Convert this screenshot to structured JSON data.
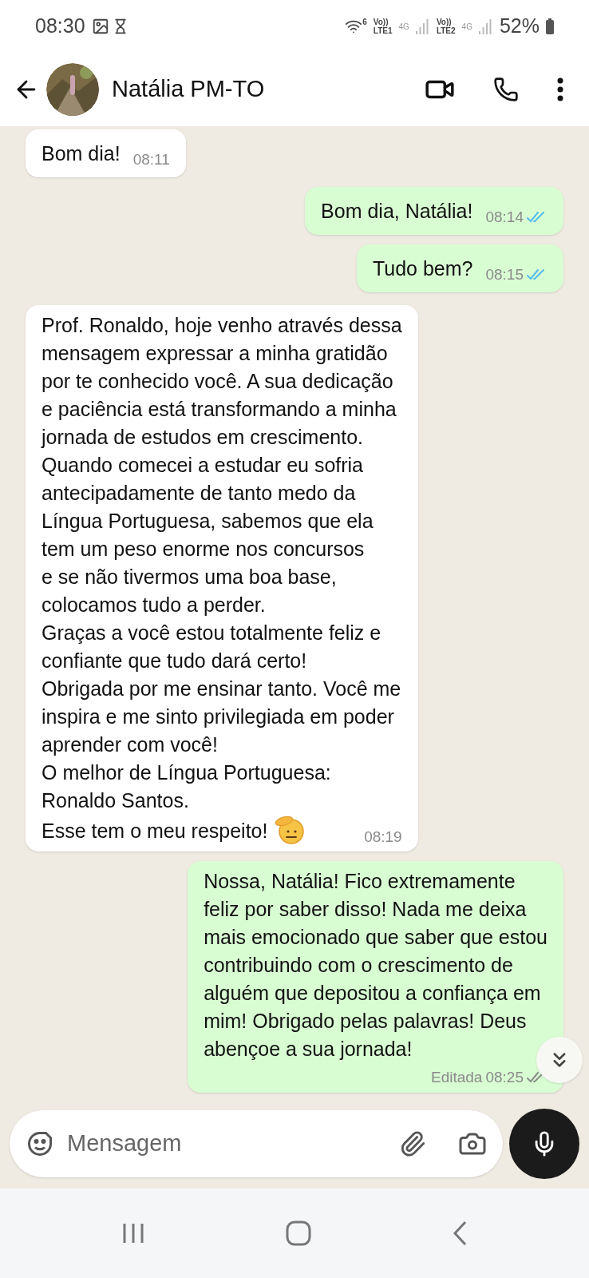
{
  "status_bar": {
    "time": "08:30",
    "wifi_label": "6",
    "sim1_label": "Vo))\nLTE1",
    "sim1_net": "4G",
    "sim2_label": "Vo))\nLTE2",
    "sim2_net": "4G",
    "battery": "52%"
  },
  "header": {
    "contact_name": "Natália PM-TO"
  },
  "messages": [
    {
      "kind": "received",
      "text": "Bom dia!",
      "time": "08:11"
    },
    {
      "kind": "sent",
      "text": "Bom dia, Natália!",
      "time": "08:14",
      "read": true
    },
    {
      "kind": "sent",
      "text": "Tudo bem?",
      "time": "08:15",
      "read": true
    },
    {
      "kind": "received",
      "text": "Prof. Ronaldo, hoje venho através dessa\nmensagem expressar a minha gratidão\npor te conhecido você. A sua dedicação\ne paciência está transformando a minha\njornada de estudos em crescimento.\nQuando comecei a estudar eu sofria\nantecipadamente de tanto medo da\nLíngua Portuguesa, sabemos que ela\ntem um peso enorme nos concursos\ne se não tivermos uma boa base,\ncolocamos tudo a perder.\nGraças a você estou totalmente feliz e\nconfiante que tudo dará certo!\nObrigada por me ensinar tanto. Você me\ninspira e me sinto privilegiada em poder\naprender com você!\nO melhor de Língua Portuguesa:\nRonaldo Santos.",
      "last_line": "Esse tem o meu respeito!",
      "time": "08:19"
    },
    {
      "kind": "sent",
      "text": "Nossa, Natália! Fico extremamente\nfeliz por saber disso! Nada me deixa\nmais emocionado que saber que estou\ncontribuindo com o crescimento de\nalguém que depositou a confiança em\nmim! Obrigado pelas palavras! Deus\nabençoe a sua jornada!",
      "edited": "Editada",
      "time": "08:25",
      "read": false
    }
  ],
  "composer": {
    "placeholder": "Mensagem"
  }
}
